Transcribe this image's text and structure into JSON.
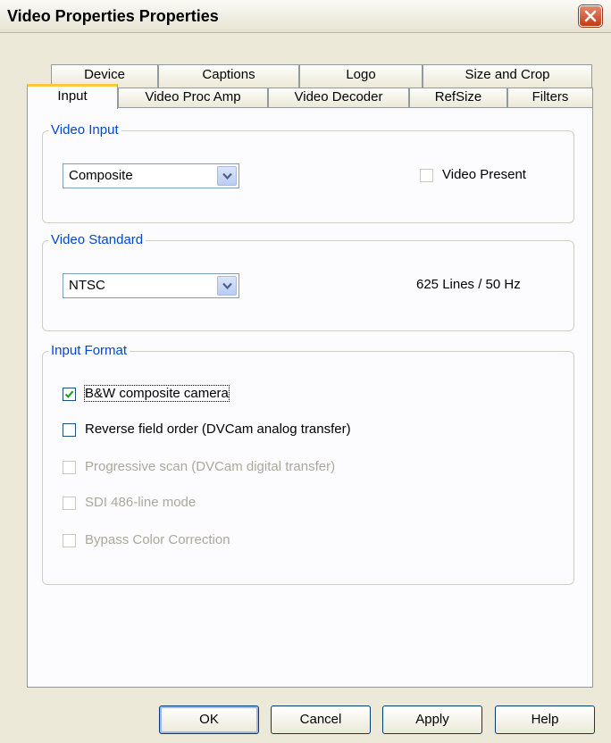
{
  "window": {
    "title": "Video Properties Properties"
  },
  "tabs": {
    "row1": [
      "Device",
      "Captions",
      "Logo",
      "Size and Crop"
    ],
    "row2": [
      "Input",
      "Video Proc Amp",
      "Video Decoder",
      "RefSize",
      "Filters"
    ],
    "active": "Input"
  },
  "video_input": {
    "title": "Video Input",
    "select_value": "Composite",
    "video_present_label": "Video Present",
    "video_present_checked": false
  },
  "video_standard": {
    "title": "Video Standard",
    "select_value": "NTSC",
    "info": "625 Lines / 50 Hz"
  },
  "input_format": {
    "title": "Input Format",
    "options": [
      {
        "label": "B&W composite camera",
        "checked": true,
        "enabled": true
      },
      {
        "label": "Reverse field order (DVCam analog transfer)",
        "checked": false,
        "enabled": true
      },
      {
        "label": "Progressive scan (DVCam digital transfer)",
        "checked": false,
        "enabled": false
      },
      {
        "label": "SDI 486-line mode",
        "checked": false,
        "enabled": false
      },
      {
        "label": "Bypass Color Correction",
        "checked": false,
        "enabled": false
      }
    ]
  },
  "buttons": {
    "ok": "OK",
    "cancel": "Cancel",
    "apply": "Apply",
    "help": "Help"
  },
  "colors": {
    "accent_tab": "#ffc83c",
    "group_title": "#0046d5",
    "close_button": "#c43a16"
  }
}
